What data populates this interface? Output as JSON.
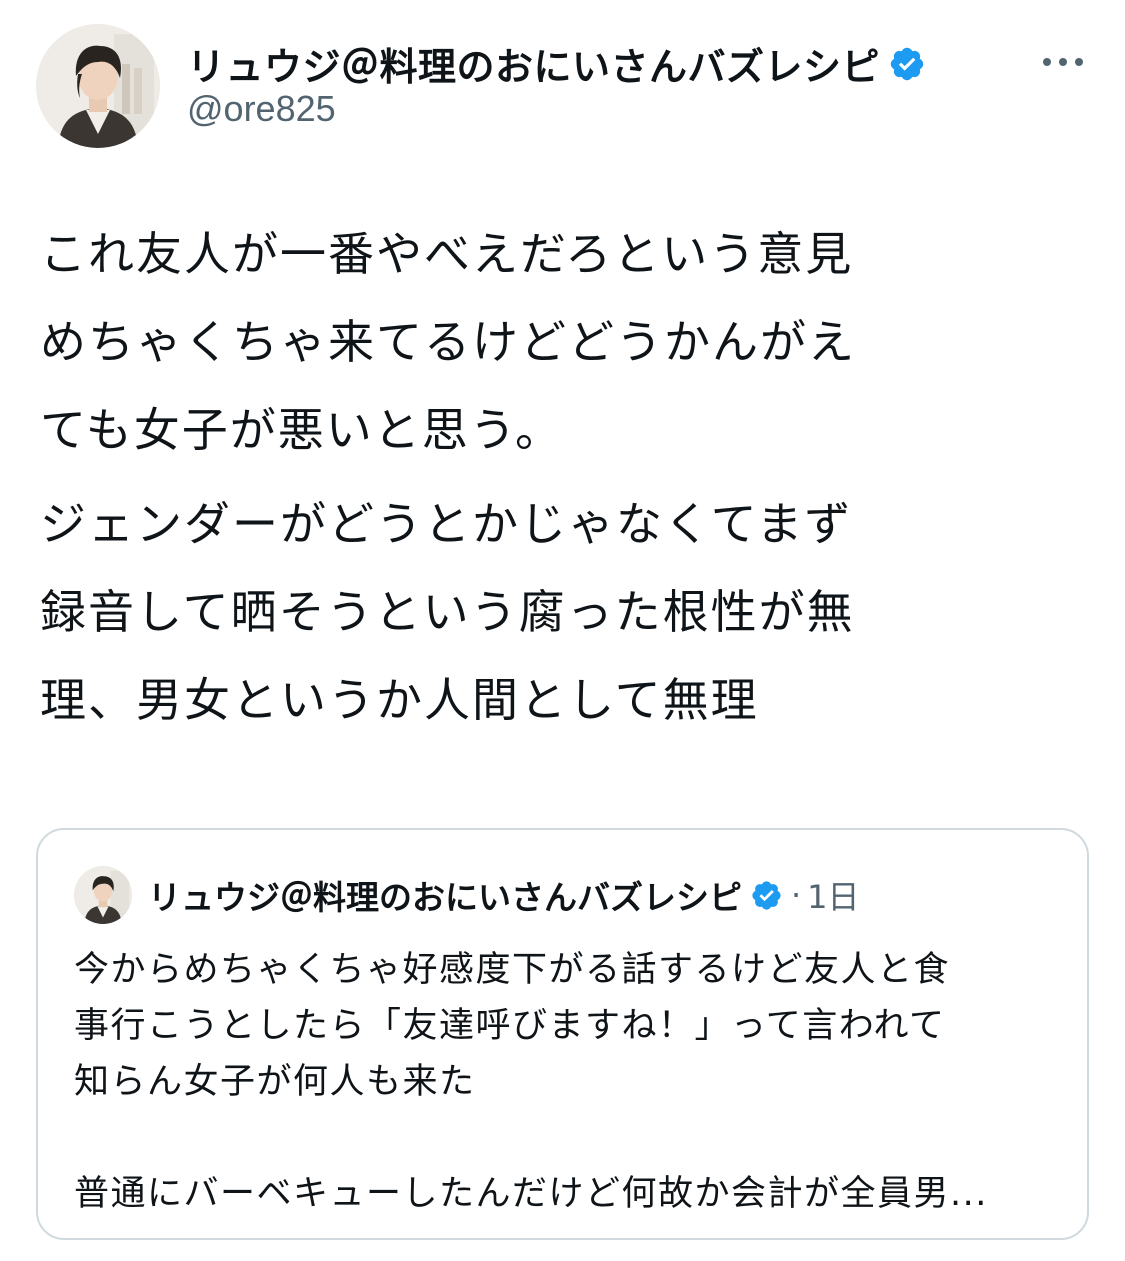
{
  "post": {
    "author_name": "リュウジ＠料理のおにいさんバズレシピ",
    "handle": "@ore825",
    "verified_color": "#1d9bf0",
    "paragraphs": [
      {
        "lines": [
          "これ友人が一番やべえだろという意見",
          "めちゃくちゃ来てるけどどうかんがえ",
          "ても女子が悪いと思う。"
        ]
      },
      {
        "lines": [
          "ジェンダーがどうとかじゃなくてまず",
          "録音して晒そうという腐った根性が無",
          "理、男女というか人間として無理"
        ]
      }
    ]
  },
  "quoted": {
    "author_name": "リュウジ＠料理のおにいさんバズレシピ",
    "separator": "·",
    "time": "1日",
    "lines": [
      "今からめちゃくちゃ好感度下がる話するけど友人と食",
      "事行こうとしたら「友達呼びますね！」って言われて",
      "知らん女子が何人も来た"
    ],
    "truncated_line": "普通にバーベキューしたんだけど何故か会計が全員男..."
  },
  "icons": {
    "more": "more-horizontal-icon",
    "verified": "verified-badge-icon"
  },
  "colors": {
    "text_primary": "#0f1419",
    "text_secondary": "#536471",
    "border": "#cfd9de"
  }
}
